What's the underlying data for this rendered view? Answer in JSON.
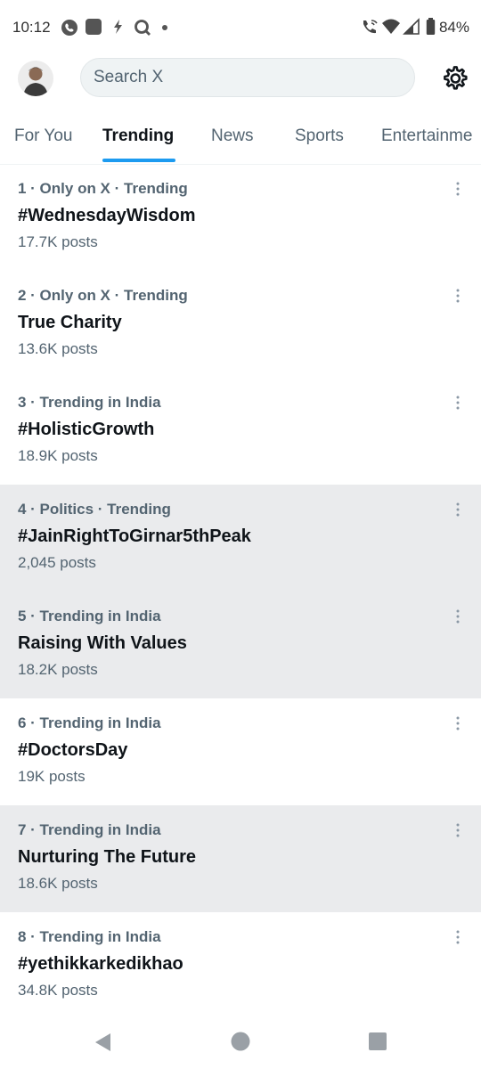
{
  "status_bar": {
    "time": "10:12",
    "battery": "84%"
  },
  "header": {
    "search_placeholder": "Search X"
  },
  "tabs": [
    {
      "label": "For You"
    },
    {
      "label": "Trending"
    },
    {
      "label": "News"
    },
    {
      "label": "Sports"
    },
    {
      "label": "Entertainme"
    }
  ],
  "trends": [
    {
      "meta": "1 · Only on X · Trending",
      "name": "#WednesdayWisdom",
      "count": "17.7K posts"
    },
    {
      "meta": "2 · Only on X · Trending",
      "name": "True Charity",
      "count": "13.6K posts"
    },
    {
      "meta": "3 · Trending in India",
      "name": "#HolisticGrowth",
      "count": "18.9K posts"
    },
    {
      "meta": "4 · Politics · Trending",
      "name": "#JainRightToGirnar5thPeak",
      "count": "2,045 posts"
    },
    {
      "meta": "5 · Trending in India",
      "name": "Raising With Values",
      "count": "18.2K posts"
    },
    {
      "meta": "6 · Trending in India",
      "name": "#DoctorsDay",
      "count": "19K posts"
    },
    {
      "meta": "7 · Trending in India",
      "name": "Nurturing The Future",
      "count": "18.6K posts"
    },
    {
      "meta": "8 · Trending in India",
      "name": "#yethikkarkedikhao",
      "count": "34.8K posts"
    }
  ],
  "colors": {
    "accent": "#1d9bf0",
    "highlight_row": "#eaebed",
    "secondary_text": "#536471"
  },
  "icons": [
    "whatsapp-icon",
    "app-icon",
    "flash-icon",
    "search-app-icon",
    "dot-icon",
    "wifi-call-icon",
    "wifi-icon",
    "signal-icon",
    "battery-icon",
    "settings-icon",
    "more-icon",
    "back-icon",
    "home-icon",
    "recents-icon"
  ]
}
